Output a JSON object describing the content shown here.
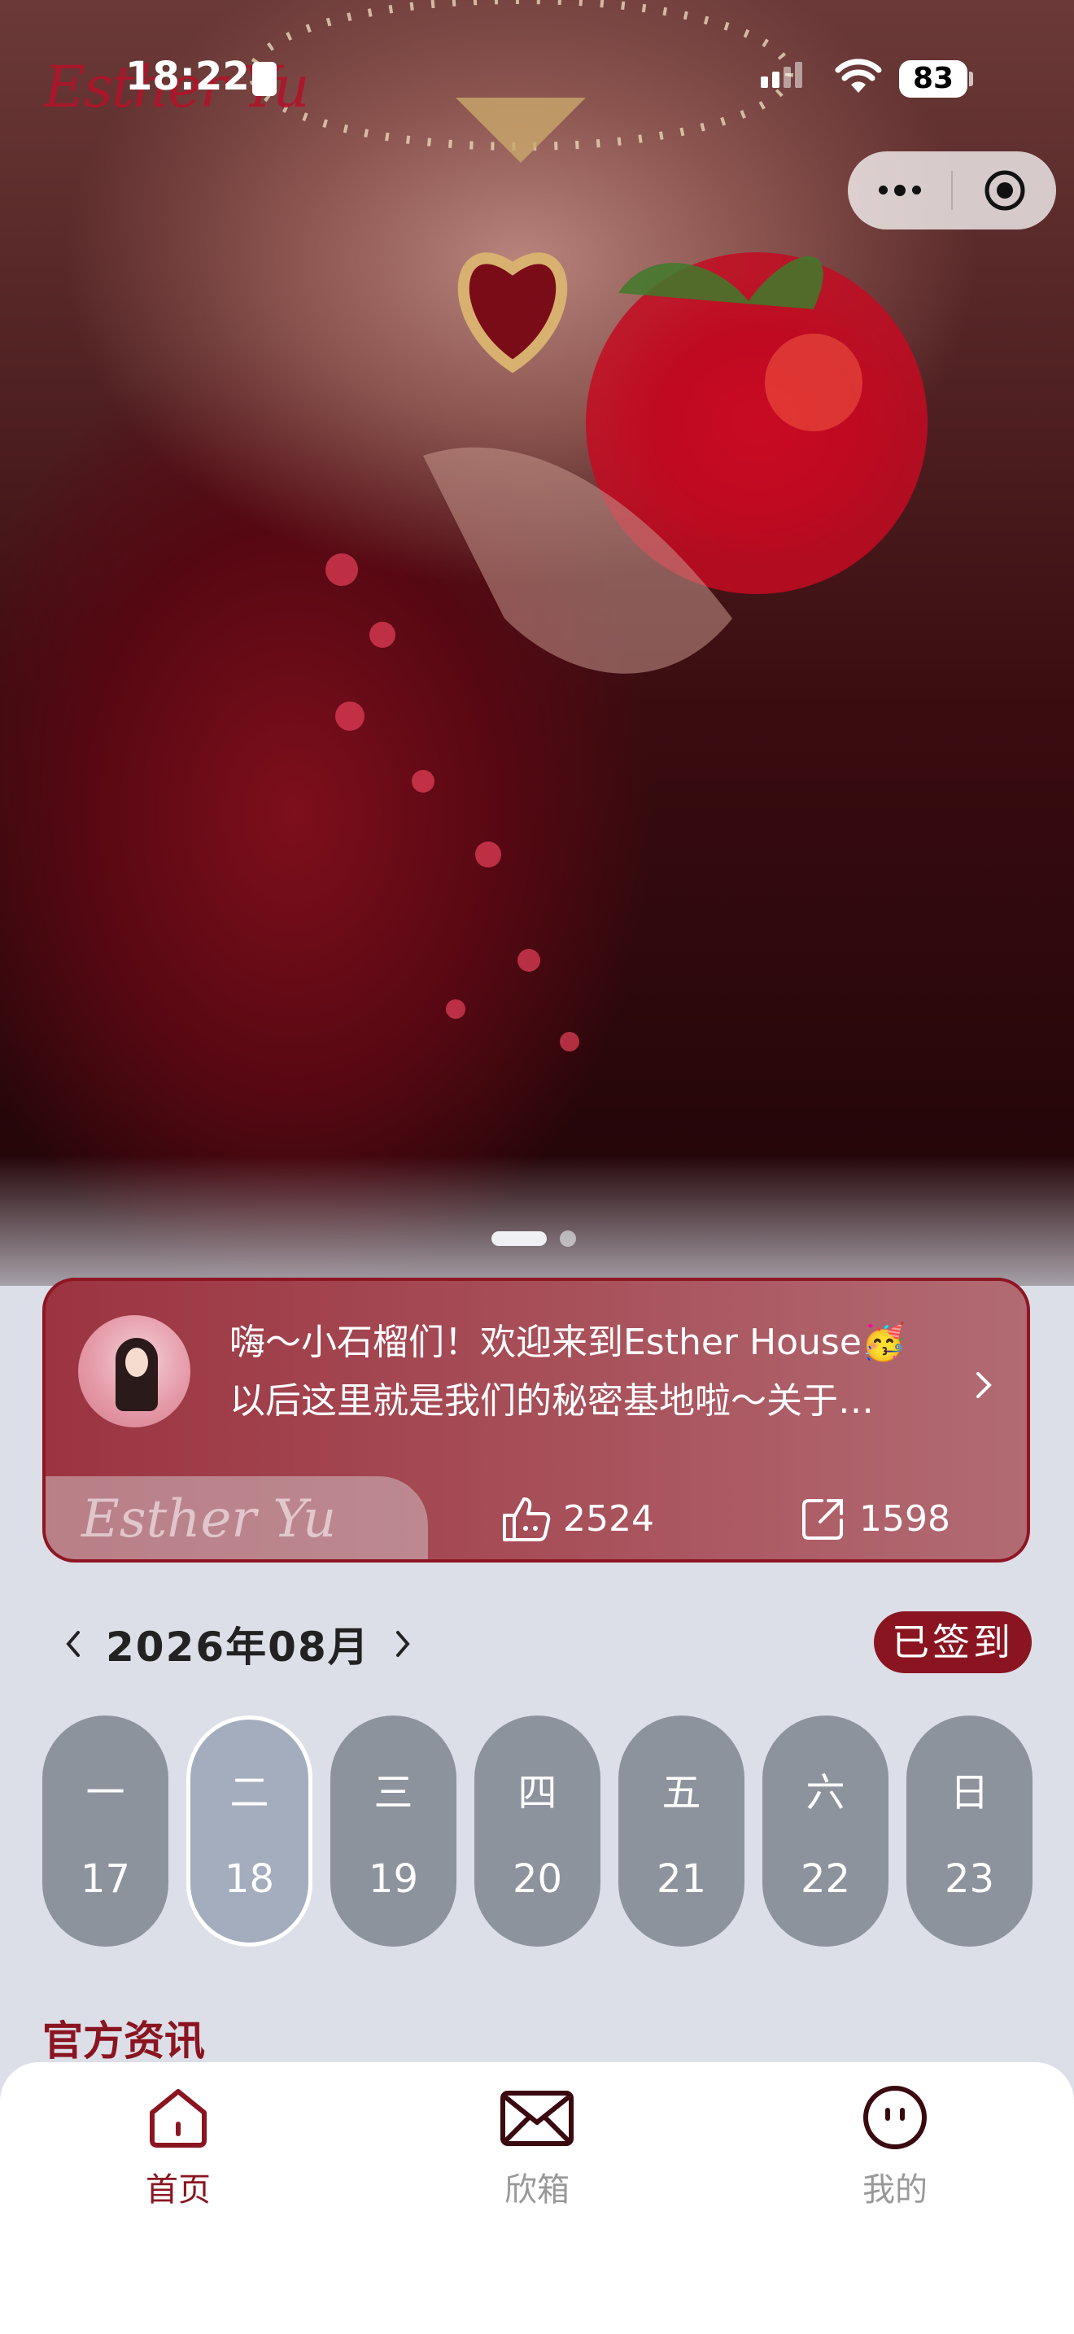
{
  "status_bar": {
    "time": "18:22",
    "battery": "83",
    "brand_script": "Esther Yu"
  },
  "capsule": {
    "more_icon": "more-dots-icon",
    "close_icon": "target-icon"
  },
  "carousel": {
    "total": 2,
    "active_index": 0
  },
  "welcome_card": {
    "line1": "嗨～小石榴们！欢迎来到Esther House🥳",
    "line2": "以后这里就是我们的秘密基地啦～关于…",
    "watermark": "Esther Yu",
    "likes": "2524",
    "shares": "1598"
  },
  "calendar": {
    "month": "2026年08月",
    "signed_label": "已签到",
    "days": [
      {
        "weekday": "一",
        "date": "17"
      },
      {
        "weekday": "二",
        "date": "18"
      },
      {
        "weekday": "三",
        "date": "19"
      },
      {
        "weekday": "四",
        "date": "20"
      },
      {
        "weekday": "五",
        "date": "21"
      },
      {
        "weekday": "六",
        "date": "22"
      },
      {
        "weekday": "日",
        "date": "23"
      }
    ],
    "selected_index": 1
  },
  "section": {
    "title": "官方资讯"
  },
  "tabbar": {
    "items": [
      {
        "label": "首页",
        "icon": "home-icon",
        "active": true
      },
      {
        "label": "欣箱",
        "icon": "mail-icon",
        "active": false
      },
      {
        "label": "我的",
        "icon": "face-icon",
        "active": false
      }
    ]
  },
  "colors": {
    "accent": "#8a1521",
    "day_pill": "#8d939d",
    "page_bg": "#dcdfe8"
  }
}
